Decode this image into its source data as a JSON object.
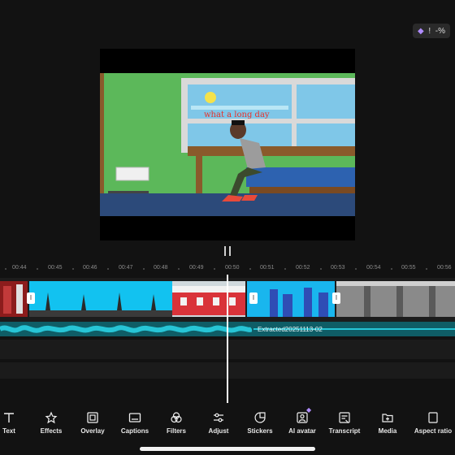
{
  "badge": {
    "gem_icon": "gem-icon",
    "left_text": "!",
    "right_text": "-%"
  },
  "preview": {
    "caption": "what a long day",
    "colors": {
      "wall": "#5cb85a",
      "window": "#7fc7e8",
      "floor": "#2c4a7a",
      "table": "#8a5a2b",
      "bed": "#2d62b0"
    }
  },
  "playback": {
    "state": "paused"
  },
  "timeline": {
    "ruler": [
      "00:44",
      "00:45",
      "00:46",
      "00:47",
      "00:48",
      "00:49",
      "00:50",
      "00:51",
      "00:52",
      "00:53",
      "00:54",
      "00:55",
      "00:56"
    ],
    "audio_label": "Extracted20251113-02",
    "handle_label": "I"
  },
  "toolbar": {
    "items": [
      {
        "label": "Text",
        "icon": "text-icon"
      },
      {
        "label": "Effects",
        "icon": "effects-icon"
      },
      {
        "label": "Overlay",
        "icon": "overlay-icon"
      },
      {
        "label": "Captions",
        "icon": "captions-icon"
      },
      {
        "label": "Filters",
        "icon": "filters-icon"
      },
      {
        "label": "Adjust",
        "icon": "adjust-icon"
      },
      {
        "label": "Stickers",
        "icon": "stickers-icon"
      },
      {
        "label": "AI avatar",
        "icon": "ai-avatar-icon"
      },
      {
        "label": "Transcript",
        "icon": "transcript-icon"
      },
      {
        "label": "Media",
        "icon": "media-icon"
      },
      {
        "label": "Aspect ratio",
        "icon": "aspect-ratio-icon"
      }
    ]
  }
}
